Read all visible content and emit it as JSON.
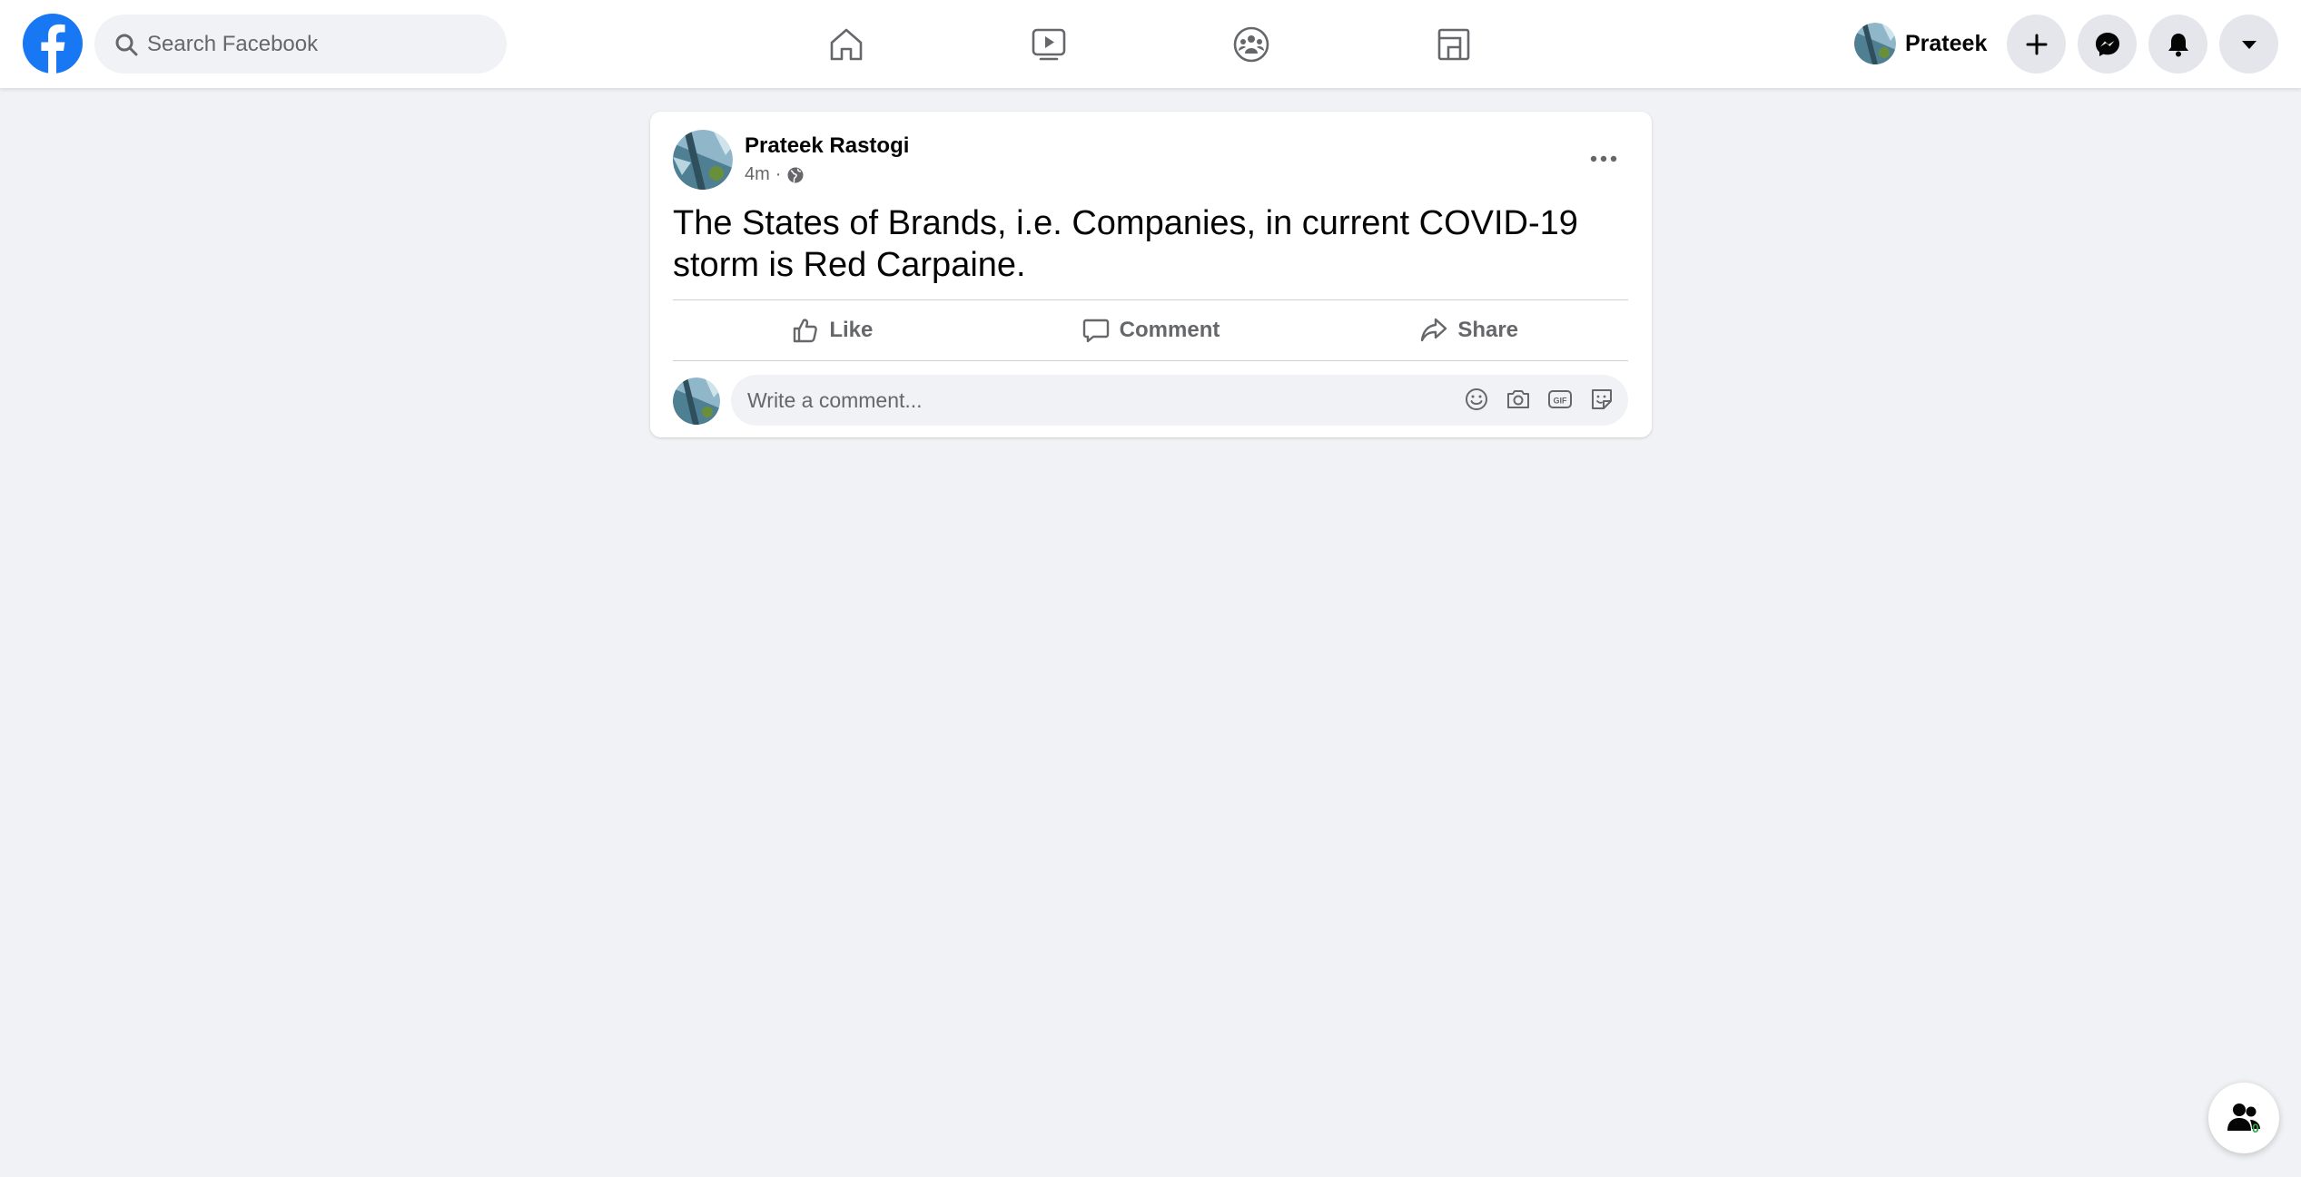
{
  "colors": {
    "brand": "#1877f2",
    "background": "#f0f2f5",
    "card": "#ffffff",
    "text_primary": "#050505",
    "text_secondary": "#65676b",
    "online": "#31a24c"
  },
  "header": {
    "search": {
      "placeholder": "Search Facebook",
      "value": ""
    },
    "nav_tabs": [
      {
        "icon": "home-icon"
      },
      {
        "icon": "watch-icon"
      },
      {
        "icon": "groups-icon"
      },
      {
        "icon": "gaming-icon"
      }
    ],
    "profile": {
      "name": "Prateek"
    },
    "buttons": [
      "create-icon",
      "messenger-icon",
      "notifications-icon",
      "account-menu-icon"
    ]
  },
  "post": {
    "author": "Prateek Rastogi",
    "time": "4m",
    "separator": "·",
    "privacy_icon": "globe-icon",
    "text": "The States of Brands, i.e. Companies, in current COVID-19 storm is Red Carpaine.",
    "actions": {
      "like": "Like",
      "comment": "Comment",
      "share": "Share"
    },
    "comment_input": {
      "placeholder": "Write a comment...",
      "value": ""
    },
    "comment_tools": [
      "emoji-icon",
      "camera-icon",
      "gif-icon",
      "sticker-icon"
    ]
  },
  "floating_contacts": {
    "count": "0"
  }
}
